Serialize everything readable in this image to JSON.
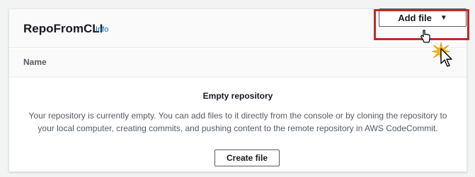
{
  "repo": {
    "name": "RepoFromCLI",
    "info_label": "Info"
  },
  "actions": {
    "add_file_label": "Add file"
  },
  "table": {
    "column_name": "Name"
  },
  "empty_state": {
    "title": "Empty repository",
    "message": "Your repository is currently empty. You can add files to it directly from the console or by cloning the repository to your local computer, creating commits, and pushing content to the remote repository in AWS CodeCommit.",
    "create_file_label": "Create file"
  },
  "icons": [
    "caret-down-icon",
    "hand-pointer-icon",
    "mouse-cursor-icon",
    "click-spark-icon"
  ],
  "colors": {
    "highlight": "#c02a27",
    "link": "#0073bb",
    "spark": "#f5b80c"
  }
}
